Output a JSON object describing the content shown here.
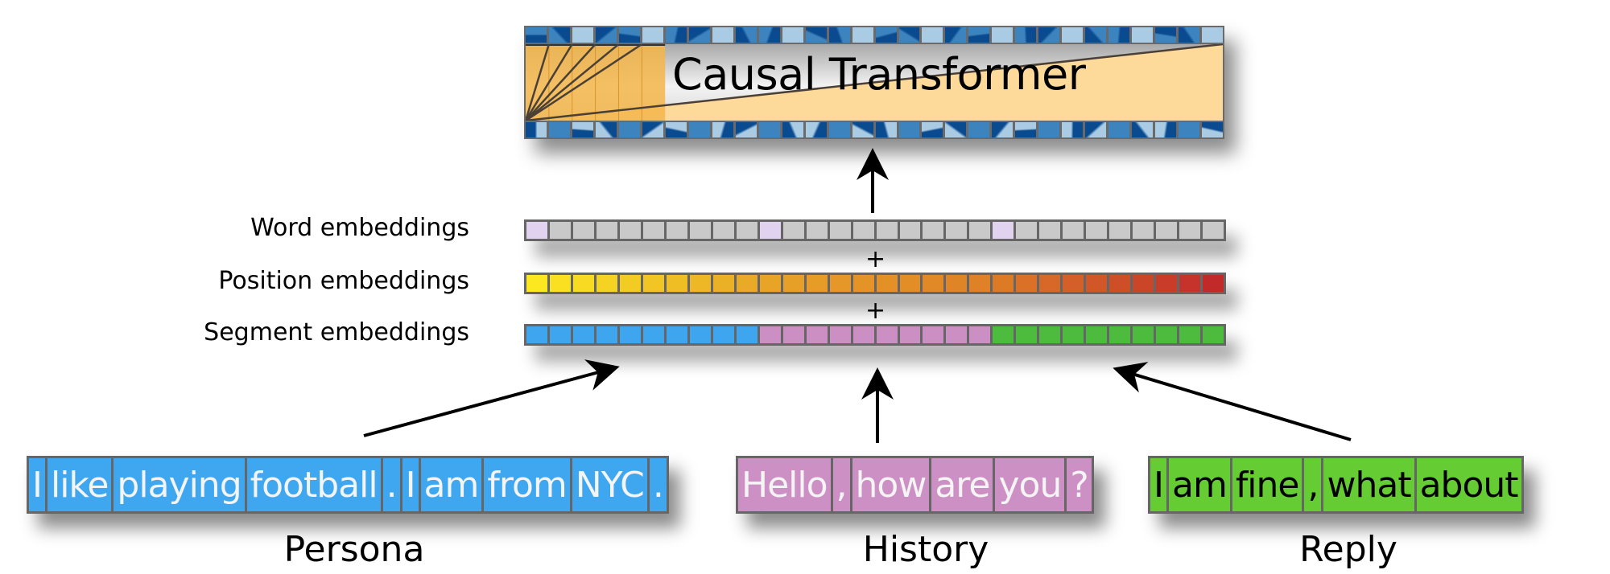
{
  "transformer": {
    "title": "Causal Transformer",
    "num_positions": 30,
    "attended_positions_shown": 6,
    "colors": {
      "band_orange": "#f5b54a",
      "band_light": "#fdd99a",
      "strip_blue_dark": "#0a4a8f",
      "strip_blue": "#3d84bf",
      "strip_light": "#a9cbe3"
    }
  },
  "embeddings": {
    "rows": [
      {
        "label": "Word embeddings",
        "kind": "word"
      },
      {
        "label": "Position embeddings",
        "kind": "position"
      },
      {
        "label": "Segment embeddings",
        "kind": "segment"
      }
    ],
    "num_cells": 30,
    "operator": "+",
    "word_highlight_indices": [
      0,
      10,
      20
    ],
    "word_colors": {
      "default": "#c9c9c9",
      "highlight": "#e1d3f0"
    },
    "position_gradient": [
      "#fbe821",
      "#e8a527",
      "#df8026",
      "#c22a2a"
    ],
    "segment_spans": [
      {
        "segment": "Persona",
        "cells": 10,
        "color": "#3ea5ef"
      },
      {
        "segment": "History",
        "cells": 10,
        "color": "#cc8fc4"
      },
      {
        "segment": "Reply",
        "cells": 10,
        "color": "#4cbb3e"
      }
    ]
  },
  "segments": [
    {
      "name": "Persona",
      "color": "#3fa7f0",
      "text_color": "#f4f4f4",
      "tokens": [
        "I",
        "like",
        "playing",
        "football",
        ".",
        "I",
        "am",
        "from",
        "NYC",
        "."
      ]
    },
    {
      "name": "History",
      "color": "#cd90c5",
      "text_color": "#f4f4f4",
      "tokens": [
        "Hello",
        ",",
        "how",
        "are",
        "you",
        "?"
      ]
    },
    {
      "name": "Reply",
      "color": "#66cc33",
      "text_color": "#000000",
      "tokens": [
        "I",
        "am",
        "fine",
        ",",
        "what",
        "about"
      ]
    }
  ]
}
